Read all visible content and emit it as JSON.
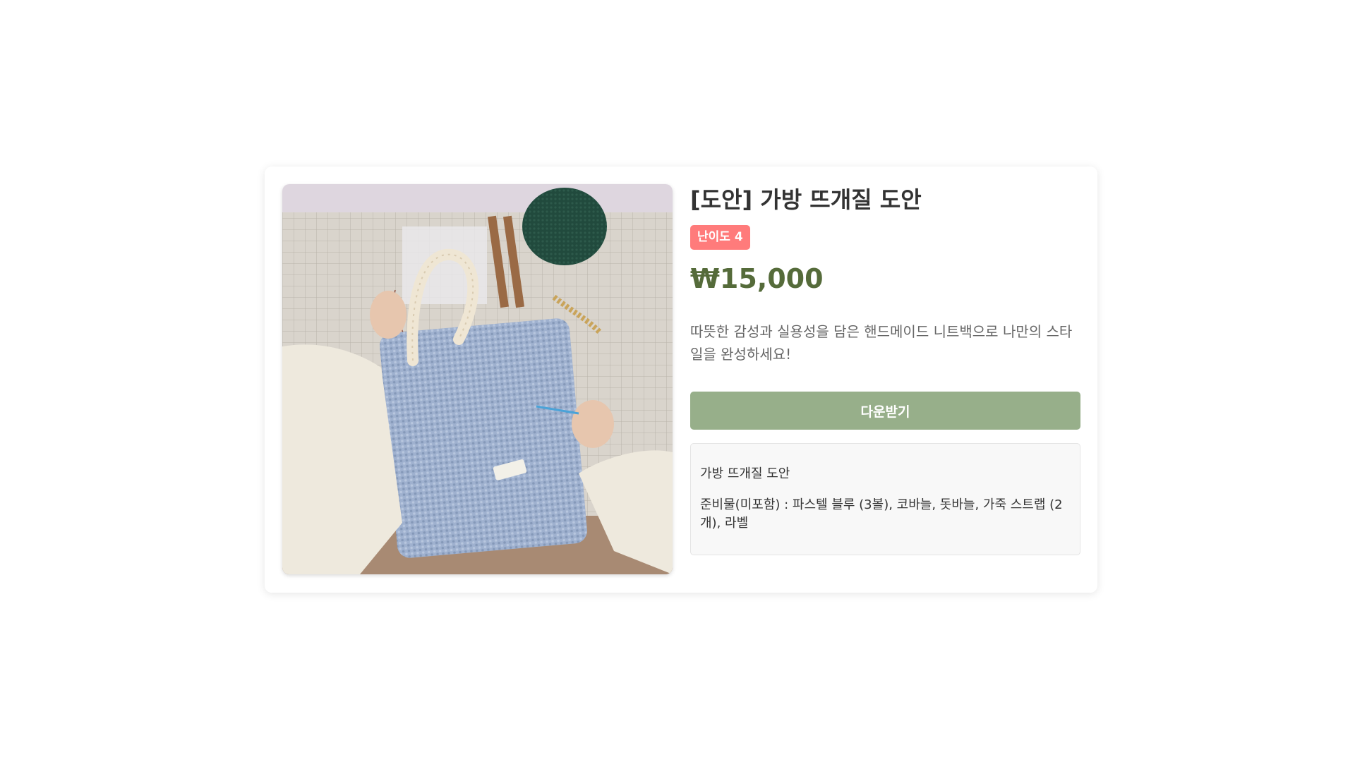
{
  "product": {
    "image_alt": "니트 가방 뜨개질 사진",
    "title": "[도안] 가방 뜨개질 도안",
    "difficulty_badge": "난이도 4",
    "price": "₩15,000",
    "description": "따뜻한 감성과 실용성을 담은 핸드메이드 니트백으로 나만의 스타일을 완성하세요!",
    "download_label": "다운받기",
    "details": {
      "name": "가방 뜨개질 도안",
      "materials": "준비물(미포함) : 파스텔 블루 (3볼), 코바늘, 돗바늘, 가죽 스트랩 (2개), 라벨"
    }
  },
  "colors": {
    "badge": "#ff7b7b",
    "price": "#556b3a",
    "button": "#97af8a"
  }
}
